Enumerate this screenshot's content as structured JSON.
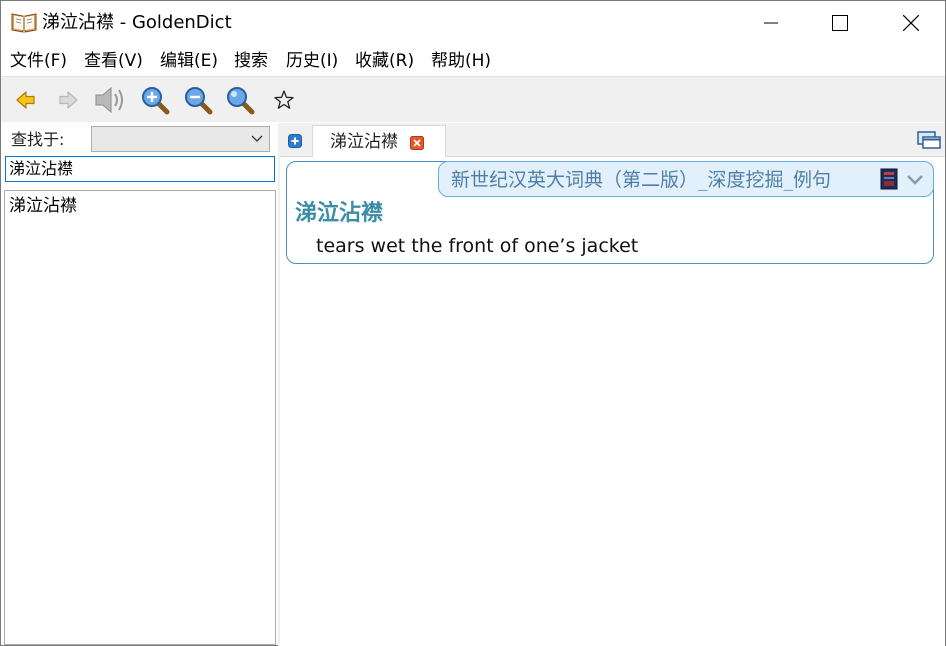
{
  "window": {
    "title": "涕泣沾襟 - GoldenDict",
    "app_icon": "open-book-icon",
    "controls": [
      "minimize-icon",
      "maximize-icon",
      "close-icon"
    ]
  },
  "menu": {
    "items": [
      "文件(F)",
      "查看(V)",
      "编辑(E)",
      "搜索",
      "历史(I)",
      "收藏(R)",
      "帮助(H)"
    ]
  },
  "toolbar": {
    "icons": [
      "back-arrow-icon",
      "forward-arrow-icon",
      "speaker-icon",
      "zoom-in-icon",
      "zoom-out-icon",
      "zoom-reset-icon",
      "star-icon"
    ]
  },
  "search": {
    "lookin_label": "查找于:",
    "lookin_value": "",
    "query": "涕泣沾襟"
  },
  "word_list": {
    "items": [
      "涕泣沾襟"
    ]
  },
  "tabs": {
    "items": [
      {
        "label": "涕泣沾襟"
      }
    ]
  },
  "article": {
    "dictionary_name": "新世纪汉英大词典（第二版）_深度挖掘_例句",
    "headword": "涕泣沾襟",
    "definition": "tears wet the front of one’s jacket"
  },
  "colors": {
    "accent": "#0078d7",
    "headword": "#3b8ea5",
    "dict_header_bg": "#e2f0fb",
    "dict_border": "#4a90c8"
  }
}
